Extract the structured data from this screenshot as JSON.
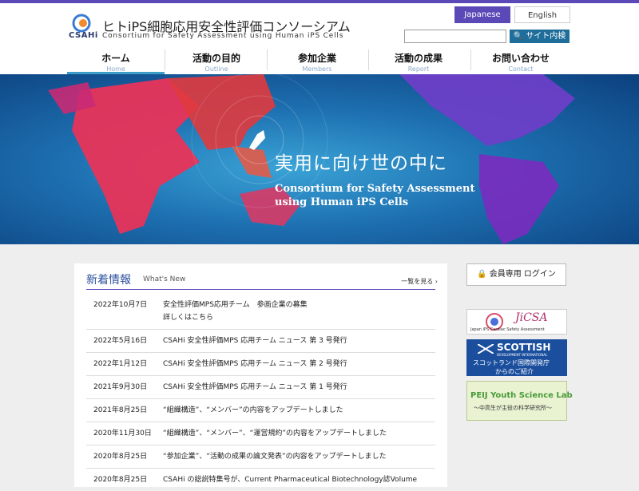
{
  "header": {
    "logo_text": "CSAHi",
    "site_title": "ヒトiPS細胞応用安全性評価コンソーシアム",
    "site_subtitle": "Consortium for Safety Assessment using Human iPS Cells"
  },
  "lang": {
    "japanese": "Japanese",
    "english": "English"
  },
  "search": {
    "placeholder": "",
    "button_label": "サイト内検索"
  },
  "nav": [
    {
      "jp": "ホーム",
      "en": "Home"
    },
    {
      "jp": "活動の目的",
      "en": "Outline"
    },
    {
      "jp": "参加企業",
      "en": "Members"
    },
    {
      "jp": "活動の成果",
      "en": "Report"
    },
    {
      "jp": "お問い合わせ",
      "en": "Contact"
    }
  ],
  "hero": {
    "title": "実用に向け世の中に",
    "sub1": "Consortium for Safety Assessment",
    "sub2": "using Human iPS Cells"
  },
  "news": {
    "title": "新着情報",
    "title_en": "What's New",
    "more": "一覧を見る ›",
    "items": [
      {
        "date": "2022年10月7日",
        "text": "安全性評価MPS応用チーム　参画企業の募集",
        "link": "詳しくはこちら"
      },
      {
        "date": "2022年5月16日",
        "text": "CSAHi 安全性評価MPS 応用チーム ニュース 第 3 号発行"
      },
      {
        "date": "2022年1月12日",
        "text": "CSAHi 安全性評価MPS 応用チーム ニュース 第 2 号発行"
      },
      {
        "date": "2021年9月30日",
        "text": "CSAHi 安全性評価MPS 応用チーム ニュース 第 1 号発行"
      },
      {
        "date": "2021年8月25日",
        "text": "“組織構造”、“メンバー”の内容をアップデートしました"
      },
      {
        "date": "2020年11月30日",
        "text": "“組織構造”、“メンバー”、“運営規約”の内容をアップデートしました"
      },
      {
        "date": "2020年8月25日",
        "text": "“参加企業”、“活動の成果の論文発表”の内容をアップデートしました"
      },
      {
        "date": "2020年8月25日",
        "text": "CSAHi の総説特集号が、Current Pharmaceutical Biotechnology誌Volume"
      }
    ]
  },
  "sidebar": {
    "login": "会員専用 ログイン",
    "jicsa_title": "JiCSA",
    "jicsa_sub": "Japan iPS Cardiac Safety Assessment",
    "scot_title": "SCOTTISH",
    "scot_sub": "DEVELOPMENT INTERNATIONAL",
    "scot_jp1": "スコットランド国際開発庁",
    "scot_jp2": "からのご紹介",
    "peij_title": "PEIJ Youth Science Lab",
    "peij_sub": "～中高生が主役の科学研究所～"
  },
  "colors": {
    "accent": "#5b49b8",
    "nav_underline": "#3d9dc9",
    "search_button": "#1e6d9a"
  }
}
